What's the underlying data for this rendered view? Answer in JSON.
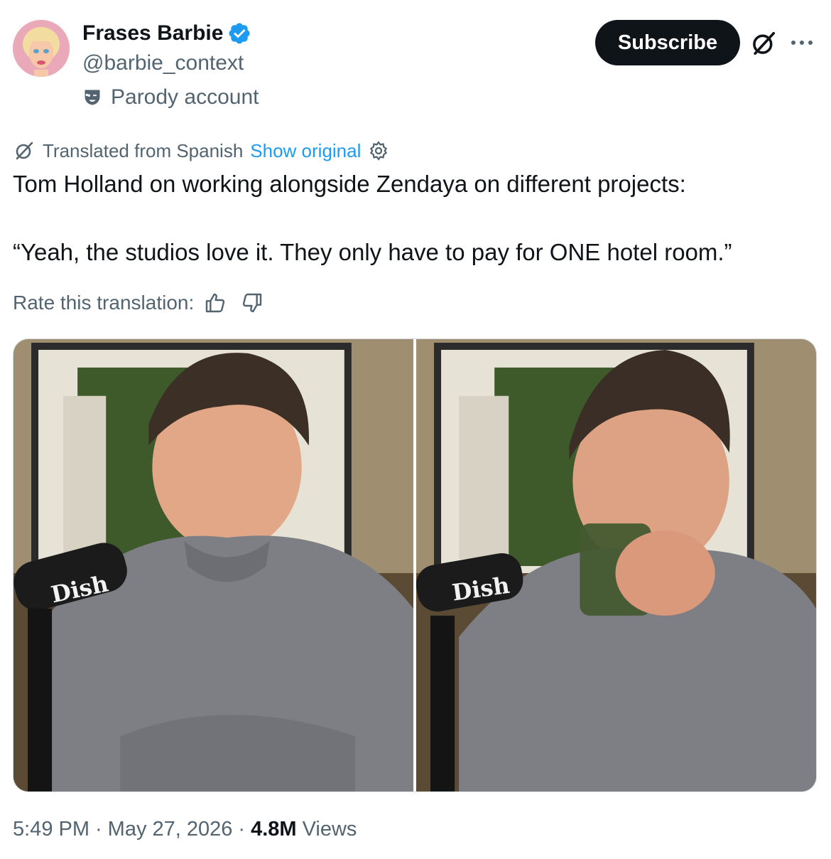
{
  "author": {
    "display_name": "Frases Barbie",
    "handle": "@barbie_context",
    "verified": true,
    "label": "Parody account"
  },
  "header": {
    "subscribe_label": "Subscribe",
    "grok_icon": "grok-icon",
    "more_icon": "more-dots-icon"
  },
  "translation": {
    "notice": "Translated from Spanish",
    "show_original": "Show original",
    "rate_label": "Rate this translation:"
  },
  "tweet": {
    "line1": "Tom Holland on working alongside Zendaya on different projects:",
    "line2": "“Yeah, the studios love it. They only have to pay for ONE hotel room.”"
  },
  "media": {
    "photos": [
      {
        "mic_brand": "Dish"
      },
      {
        "mic_brand": "Dish"
      }
    ]
  },
  "meta": {
    "time": "5:49 PM",
    "separator": "·",
    "date": "May 27, 2026",
    "views_count": "4.8M",
    "views_label": "Views"
  },
  "colors": {
    "text_primary": "#0f1419",
    "text_secondary": "#536471",
    "link": "#1d9bf0",
    "verified": "#1d9bf0"
  }
}
